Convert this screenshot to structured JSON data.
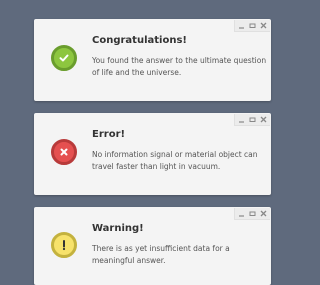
{
  "colors": {
    "background": "#5f6a7d",
    "card": "#f4f4f4",
    "success": "#8dc63f",
    "error": "#e55050",
    "warning": "#f7e26b"
  },
  "window_controls": {
    "minimize": "_",
    "maximize": "□",
    "close": "×"
  },
  "notifications": [
    {
      "type": "success",
      "icon": "check-icon",
      "title": "Congratulations!",
      "message": "You found the answer to the ultimate question of life and the universe."
    },
    {
      "type": "error",
      "icon": "x-icon",
      "title": "Error!",
      "message": "No information signal or material object can travel faster than light in vacuum."
    },
    {
      "type": "warning",
      "icon": "exclamation-icon",
      "title": "Warning!",
      "message": "There is as yet insufficient data for a meaningful answer."
    }
  ]
}
